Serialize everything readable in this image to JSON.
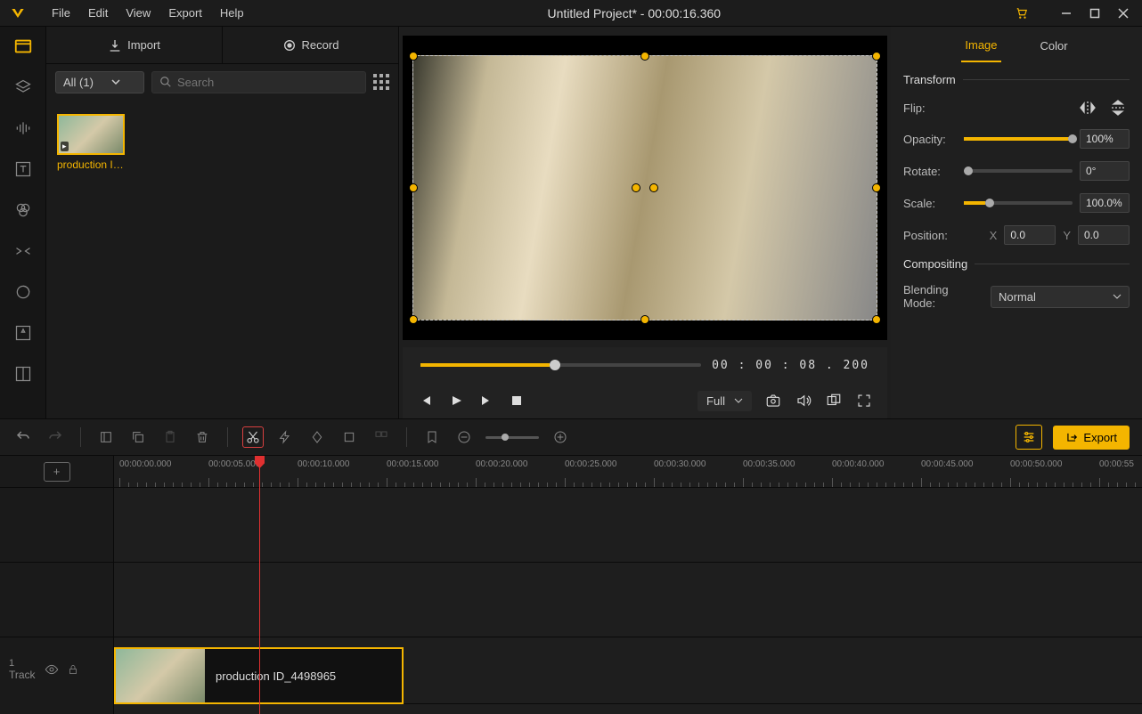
{
  "titlebar": {
    "menus": [
      "File",
      "Edit",
      "View",
      "Export",
      "Help"
    ],
    "title": "Untitled Project* - 00:00:16.360"
  },
  "media": {
    "tabs": {
      "import": "Import",
      "record": "Record"
    },
    "filter": "All (1)",
    "search_placeholder": "Search",
    "item": {
      "label": "production I…"
    }
  },
  "preview": {
    "timecode": "00 : 00 : 08 . 200",
    "full": "Full"
  },
  "props": {
    "tabs": {
      "image": "Image",
      "color": "Color"
    },
    "transform_hdr": "Transform",
    "flip_label": "Flip:",
    "opacity_label": "Opacity:",
    "opacity_val": "100%",
    "rotate_label": "Rotate:",
    "rotate_val": "0°",
    "scale_label": "Scale:",
    "scale_val": "100.0%",
    "position_label": "Position:",
    "pos_x_label": "X",
    "pos_x": "0.0",
    "pos_y_label": "Y",
    "pos_y": "0.0",
    "compositing_hdr": "Compositing",
    "blend_label": "Blending Mode:",
    "blend_val": "Normal"
  },
  "toolbar": {
    "export": "Export"
  },
  "timeline": {
    "marks": [
      "00:00:00.000",
      "00:00:05.000",
      "00:00:10.000",
      "00:00:15.000",
      "00:00:20.000",
      "00:00:25.000",
      "00:00:30.000",
      "00:00:35.000",
      "00:00:40.000",
      "00:00:45.000",
      "00:00:50.000",
      "00:00:55"
    ],
    "track_num": "1",
    "track_label": "Track",
    "clip_label": "production ID_4498965"
  }
}
